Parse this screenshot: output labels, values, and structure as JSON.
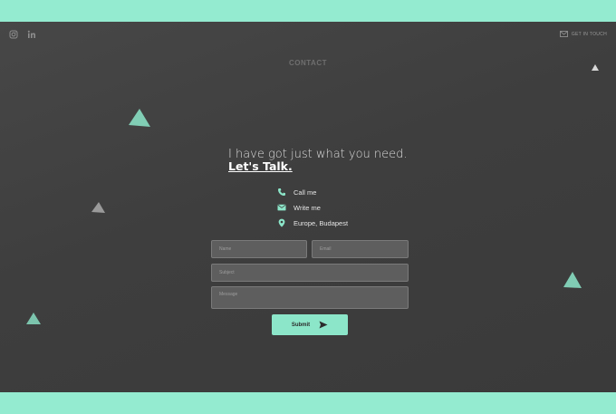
{
  "header": {
    "social_icons": [
      "instagram-icon",
      "linkedin-icon"
    ],
    "get_in_touch_label": "GET IN TOUCH",
    "nav_title": "CONTACT"
  },
  "hero": {
    "headline": "I have got just what you need.",
    "cta": "Let's Talk."
  },
  "contact_info": {
    "items": [
      {
        "icon": "phone-icon",
        "label": "Call me"
      },
      {
        "icon": "mail-icon",
        "label": "Write me"
      },
      {
        "icon": "location-pin-icon",
        "label": "Europe, Budapest"
      }
    ]
  },
  "form": {
    "name_placeholder": "Name",
    "email_placeholder": "Email",
    "subject_placeholder": "Subject",
    "message_placeholder": "Message",
    "submit_label": "Submit"
  },
  "colors": {
    "accent": "#8ce6c9",
    "background": "#424242",
    "outer": "#94ebd0"
  }
}
